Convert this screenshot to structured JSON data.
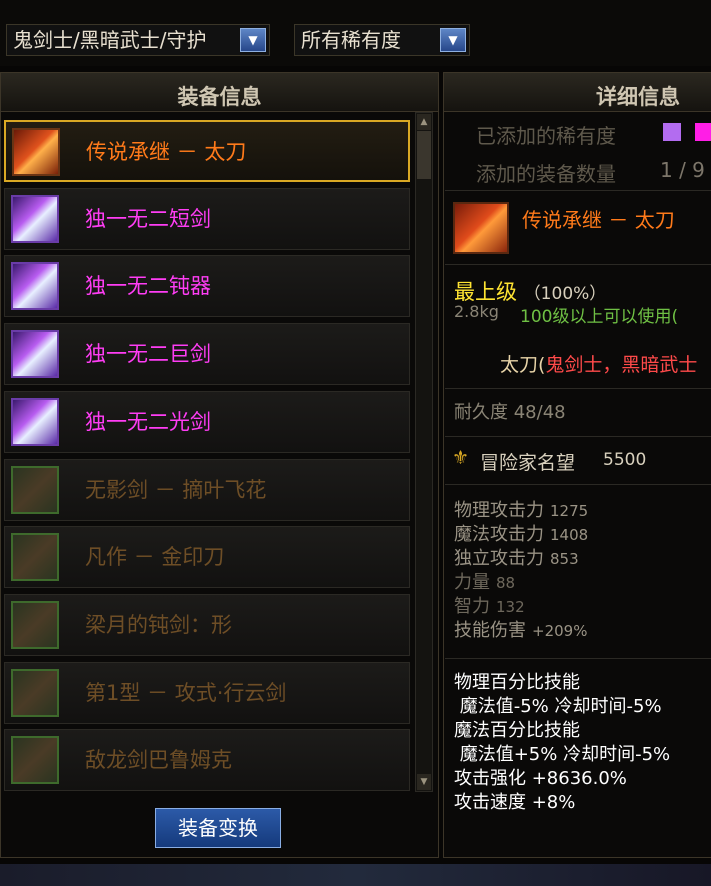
{
  "filters": {
    "class_filter": "鬼剑士/黑暗武士/守护",
    "rarity_filter": "所有稀有度"
  },
  "left_panel": {
    "title": "装备信息",
    "items": [
      {
        "name": "传说承继 － 太刀",
        "rarity": "legendary",
        "selected": true,
        "icon": "katana-icon"
      },
      {
        "name": "独一无二短剑",
        "rarity": "unique",
        "selected": false,
        "icon": "short-sword-icon"
      },
      {
        "name": "独一无二钝器",
        "rarity": "unique",
        "selected": false,
        "icon": "blunt-weapon-icon"
      },
      {
        "name": "独一无二巨剑",
        "rarity": "unique",
        "selected": false,
        "icon": "great-sword-icon"
      },
      {
        "name": "独一无二光剑",
        "rarity": "unique",
        "selected": false,
        "icon": "lightsaber-icon"
      },
      {
        "name": "无影剑 － 摘叶飞花",
        "rarity": "disabled",
        "selected": false,
        "icon": "sword-icon"
      },
      {
        "name": "凡作 － 金印刀",
        "rarity": "disabled",
        "selected": false,
        "icon": "blade-icon"
      },
      {
        "name": "梁月的钝剑：形",
        "rarity": "disabled",
        "selected": false,
        "icon": "blunt-sword-icon"
      },
      {
        "name": "第1型 － 攻式·行云剑",
        "rarity": "disabled",
        "selected": false,
        "icon": "sword-icon"
      },
      {
        "name": "敌龙剑巴鲁姆克",
        "rarity": "disabled",
        "selected": false,
        "icon": "dragon-sword-icon"
      }
    ],
    "swap_button": "装备变换"
  },
  "right_panel": {
    "title": "详细信息",
    "added_rarity_label": "已添加的稀有度",
    "added_count_label": "添加的装备数量",
    "added_count_value": "1 / 9",
    "rarity_colors": [
      "#b36cf0",
      "#ff1ee6"
    ],
    "item_name": "传说承继 － 太刀",
    "grade": "最上级",
    "grade_pct": "（100%）",
    "weight": "2.8kg",
    "level_req": "100级以上可以使用(",
    "type_prefix": "太刀(",
    "type_classes": "鬼剑士，黑暗武士",
    "durability": "耐久度 48/48",
    "fame_label": "冒险家名望",
    "fame_value": "5500",
    "stats": [
      {
        "label": "物理攻击力",
        "value": "1275"
      },
      {
        "label": "魔法攻击力",
        "value": "1408"
      },
      {
        "label": "独立攻击力",
        "value": "853"
      },
      {
        "label": "力量",
        "value": "88"
      },
      {
        "label": "智力",
        "value": "132"
      },
      {
        "label": "技能伤害",
        "value": "+209%"
      }
    ],
    "effects": [
      "物理百分比技能",
      " 魔法值-5% 冷却时间-5%",
      "魔法百分比技能",
      " 魔法值+5% 冷却时间-5%",
      "攻击强化 +8636.0%",
      "攻击速度 +8%"
    ]
  }
}
